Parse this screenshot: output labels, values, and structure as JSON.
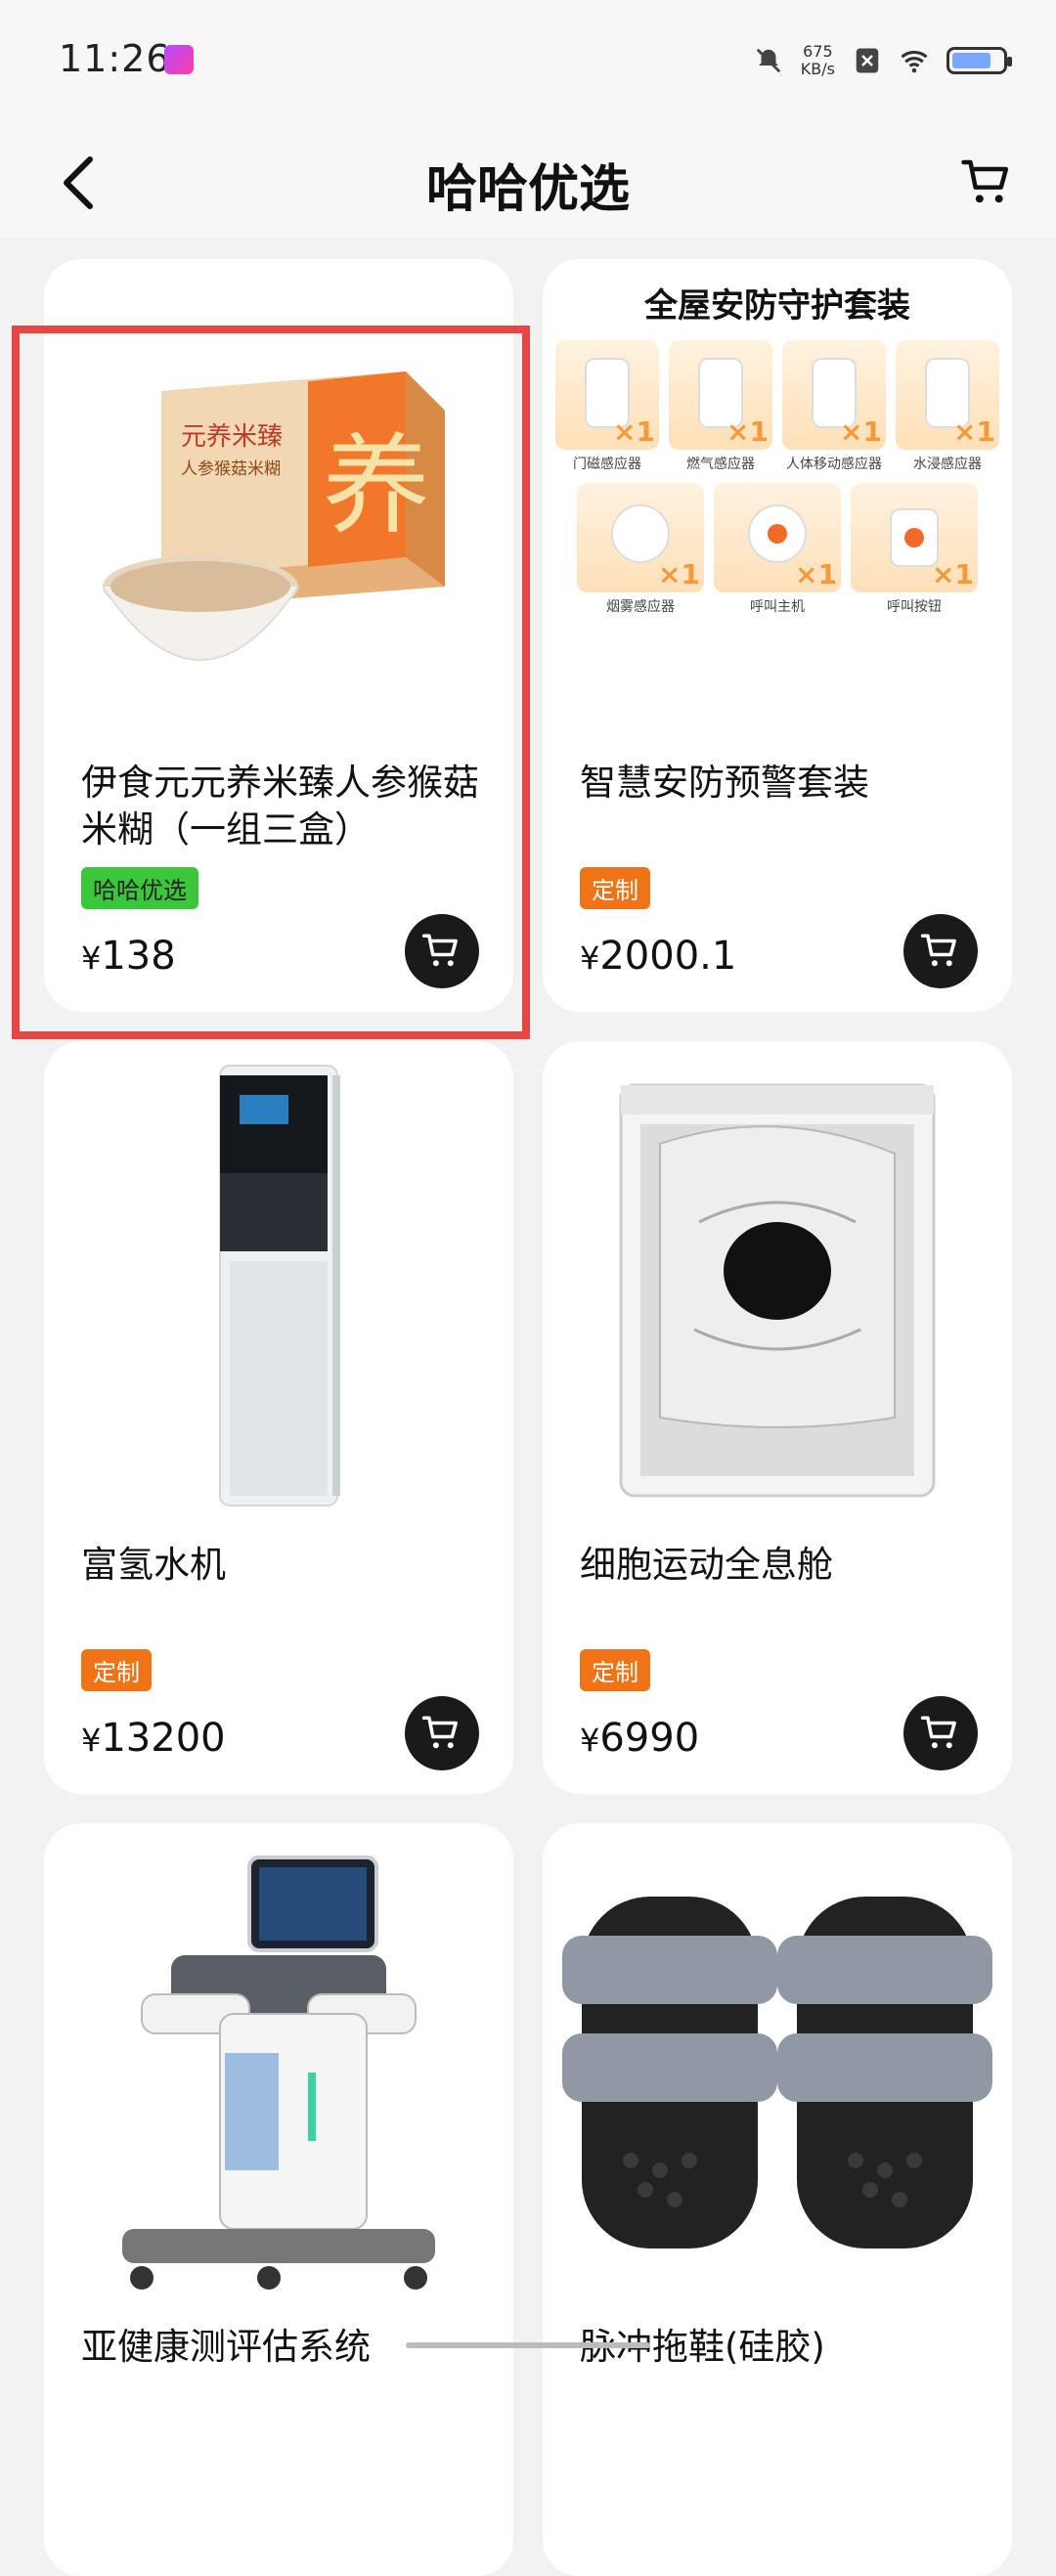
{
  "status_bar": {
    "time": "11:26",
    "net_speed_value": "675",
    "net_speed_unit": "KB/s"
  },
  "nav": {
    "title": "哈哈优选"
  },
  "products": [
    {
      "title": "伊食元元养米臻人参猴菇米糊（一组三盒）",
      "tag": "哈哈优选",
      "tag_color": "#3bc63b",
      "currency": "¥",
      "price": "138"
    },
    {
      "title": "智慧安防预警套装",
      "tag": "定制",
      "tag_color": "#f07315",
      "currency": "¥",
      "price": "2000.1"
    },
    {
      "title": "富氢水机",
      "tag": "定制",
      "tag_color": "#f07315",
      "currency": "¥",
      "price": "13200"
    },
    {
      "title": "细胞运动全息舱",
      "tag": "定制",
      "tag_color": "#f07315",
      "currency": "¥",
      "price": "6990"
    },
    {
      "title": "亚健康测评估系统",
      "tag": "",
      "currency": "",
      "price": ""
    },
    {
      "title": "脉冲拖鞋(硅胶)",
      "tag": "",
      "currency": "",
      "price": ""
    }
  ],
  "security_kit": {
    "heading": "全屋安防守护套装",
    "quantity": "×1",
    "items": [
      "门磁感应器",
      "燃气感应器",
      "人体移动感应器",
      "水浸感应器",
      "烟雾感应器",
      "呼叫主机",
      "呼叫按钮"
    ]
  },
  "product_box_text": {
    "brand_line1": "元养米臻",
    "brand_line2": "人参猴菇米糊",
    "big_char": "养"
  },
  "icons": {
    "back": "chevron-left-icon",
    "cart": "shopping-cart-icon",
    "silent": "bell-off-icon",
    "wifi": "wifi-icon",
    "battery": "battery-icon"
  }
}
